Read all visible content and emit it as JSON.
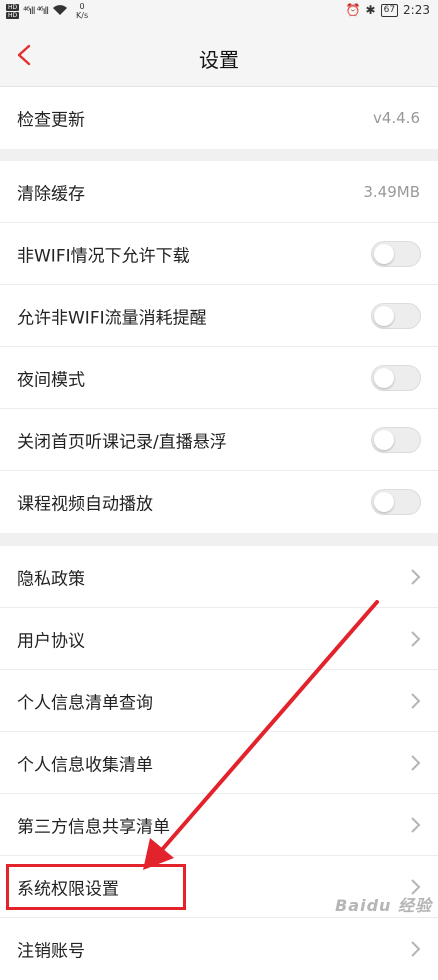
{
  "statusbar": {
    "hd1": "HD",
    "hd2": "HD",
    "signal": "⁴⁶ıll ⁴⁶ıll",
    "speed_value": "0",
    "speed_unit": "K/s",
    "battery": "67",
    "time": "2:23"
  },
  "navbar": {
    "title": "设置"
  },
  "rows": {
    "check_update": {
      "label": "检查更新",
      "value": "v4.4.6"
    },
    "clear_cache": {
      "label": "清除缓存",
      "value": "3.49MB"
    },
    "non_wifi_download": {
      "label": "非WIFI情况下允许下载",
      "on": false
    },
    "non_wifi_alert": {
      "label": "允许非WIFI流量消耗提醒",
      "on": false
    },
    "night_mode": {
      "label": "夜间模式",
      "on": false
    },
    "close_float": {
      "label": "关闭首页听课记录/直播悬浮",
      "on": false
    },
    "autoplay": {
      "label": "课程视频自动播放",
      "on": false
    },
    "privacy": {
      "label": "隐私政策"
    },
    "user_agreement": {
      "label": "用户协议"
    },
    "personal_info_query": {
      "label": "个人信息清单查询"
    },
    "personal_info_collect": {
      "label": "个人信息收集清单"
    },
    "third_party": {
      "label": "第三方信息共享清单"
    },
    "system_permission": {
      "label": "系统权限设置"
    },
    "logout_account": {
      "label": "注销账号"
    }
  },
  "annotation": {
    "color": "#e3232c"
  },
  "watermark": "Baidu 经验"
}
